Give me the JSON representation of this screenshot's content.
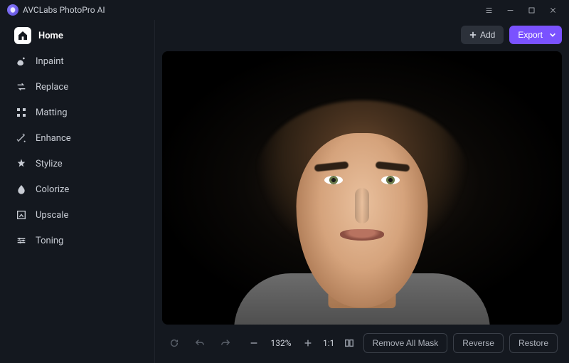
{
  "app": {
    "title": "AVCLabs PhotoPro AI"
  },
  "sidebar": {
    "items": [
      {
        "label": "Home"
      },
      {
        "label": "Inpaint"
      },
      {
        "label": "Replace"
      },
      {
        "label": "Matting"
      },
      {
        "label": "Enhance"
      },
      {
        "label": "Stylize"
      },
      {
        "label": "Colorize"
      },
      {
        "label": "Upscale"
      },
      {
        "label": "Toning"
      }
    ]
  },
  "topbar": {
    "add_label": "Add",
    "export_label": "Export"
  },
  "bottombar": {
    "zoom": "132%",
    "fit_label": "1:1",
    "remove_mask_label": "Remove All Mask",
    "reverse_label": "Reverse",
    "restore_label": "Restore"
  }
}
